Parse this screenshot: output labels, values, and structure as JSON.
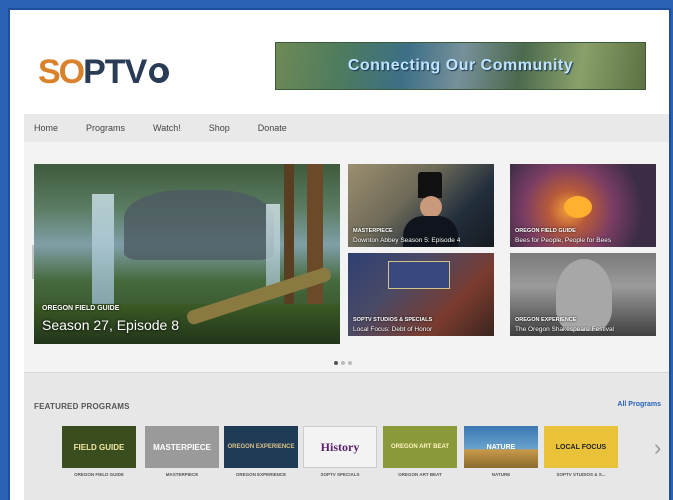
{
  "header": {
    "logo_part1": "SO",
    "logo_part2": "PTV",
    "banner_text": "Connecting Our Community"
  },
  "nav": {
    "items": [
      "Home",
      "Programs",
      "Watch!",
      "Shop",
      "Donate"
    ]
  },
  "hero": {
    "series": "OREGON FIELD GUIDE",
    "title": "Season 27, Episode 8"
  },
  "tiles": [
    {
      "series": "MASTERPIECE",
      "title": "Downton Abbey Season 5: Episode 4"
    },
    {
      "series": "OREGON FIELD GUIDE",
      "title": "Bees for People, People for Bees"
    },
    {
      "series": "SOPTV STUDIOS & SPECIALS",
      "title": "Local Focus: Debt of Honor"
    },
    {
      "series": "OREGON EXPERIENCE",
      "title": "The Oregon Shakespeare Festival"
    }
  ],
  "carousel": {
    "pages": 3,
    "active": 1
  },
  "featured": {
    "heading": "FEATURED PROGRAMS",
    "all_link": "All Programs",
    "programs": [
      {
        "label": "OREGON FIELD GUIDE",
        "thumb": "FIELD GUIDE",
        "bg": "#3a4d1f",
        "fg": "#f2e8a0"
      },
      {
        "label": "MASTERPIECE",
        "thumb": "MASTERPIECE",
        "bg": "#9a9a9a",
        "fg": "#ffffff"
      },
      {
        "label": "OREGON EXPERIENCE",
        "thumb": "OREGON EXPERIENCE",
        "bg": "#1f3b55",
        "fg": "#d9c28a"
      },
      {
        "label": "SOPTV SPECIALS",
        "thumb": "History",
        "bg": "#f3f3f3",
        "fg": "#5a1e6a"
      },
      {
        "label": "OREGON ART BEAT",
        "thumb": "OREGON ART BEAT",
        "bg": "#8a9a3a",
        "fg": "#fff3c0"
      },
      {
        "label": "NATURE",
        "thumb": "NATURE",
        "bg": "#3a77b0",
        "fg": "#ffffff"
      },
      {
        "label": "SOPTV STUDIOS & S...",
        "thumb": "LOCAL FOCUS",
        "bg": "#e9c23a",
        "fg": "#222222"
      }
    ]
  }
}
